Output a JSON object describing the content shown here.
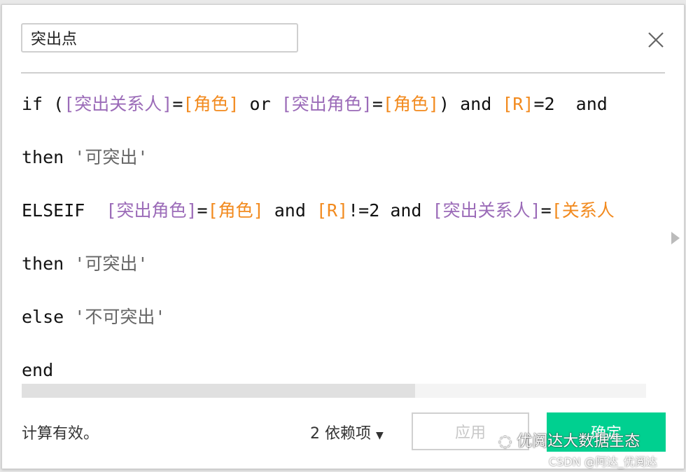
{
  "dialog": {
    "field_name": "突出点",
    "close_icon": "close-icon",
    "colors": {
      "keyword": "#111111",
      "field": "#9b6bb8",
      "param": "#f28a1e",
      "string": "#666666",
      "ok_button": "#00d090"
    },
    "code_lines": [
      [
        {
          "t": "if (",
          "c": "keyword"
        },
        {
          "t": "[突出关系人]",
          "c": "field"
        },
        {
          "t": "=",
          "c": "keyword"
        },
        {
          "t": "[角色]",
          "c": "param"
        },
        {
          "t": " or ",
          "c": "keyword"
        },
        {
          "t": "[突出角色]",
          "c": "field"
        },
        {
          "t": "=",
          "c": "keyword"
        },
        {
          "t": "[角色]",
          "c": "param"
        },
        {
          "t": ") and ",
          "c": "keyword"
        },
        {
          "t": "[R]",
          "c": "param"
        },
        {
          "t": "=2  and",
          "c": "keyword"
        }
      ],
      [
        {
          "t": "then ",
          "c": "keyword"
        },
        {
          "t": "'可突出'",
          "c": "string"
        }
      ],
      [
        {
          "t": "ELSEIF  ",
          "c": "keyword"
        },
        {
          "t": "[突出角色]",
          "c": "field"
        },
        {
          "t": "=",
          "c": "keyword"
        },
        {
          "t": "[角色]",
          "c": "param"
        },
        {
          "t": " and ",
          "c": "keyword"
        },
        {
          "t": "[R]",
          "c": "param"
        },
        {
          "t": "!=2 and ",
          "c": "keyword"
        },
        {
          "t": "[突出关系人]",
          "c": "field"
        },
        {
          "t": "=",
          "c": "keyword"
        },
        {
          "t": "[关系人",
          "c": "param"
        }
      ],
      [
        {
          "t": "then ",
          "c": "keyword"
        },
        {
          "t": "'可突出'",
          "c": "string"
        }
      ],
      [
        {
          "t": "else ",
          "c": "keyword"
        },
        {
          "t": "'不可突出'",
          "c": "string"
        }
      ],
      [
        {
          "t": "end",
          "c": "keyword"
        }
      ]
    ],
    "horizontal_scroll_fraction": 0.63,
    "status": "计算有效。",
    "dependencies": "2 依赖项",
    "apply_label": "应用",
    "ok_label": "确定"
  },
  "watermark": {
    "line1": "优阅达大数据生态",
    "line2": "CSDN @阿达_优阅达"
  }
}
